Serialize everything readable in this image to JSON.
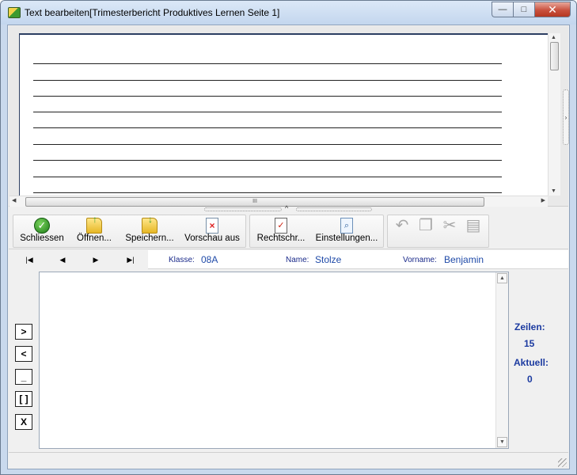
{
  "window": {
    "title": "Text bearbeiten[Trimesterbericht Produktives Lernen Seite 1]"
  },
  "titlebar_buttons": {
    "minimize": "—",
    "maximize": "□",
    "close": "✕"
  },
  "scroll": {
    "hthumb_mark": "III"
  },
  "toolbar": {
    "buttons": [
      {
        "label": "Schliessen",
        "icon": "check-icon"
      },
      {
        "label": "Öffnen...",
        "icon": "open-folder-icon"
      },
      {
        "label": "Speichern...",
        "icon": "save-folder-icon"
      },
      {
        "label": "Vorschau aus",
        "icon": "preview-off-icon"
      },
      {
        "label": "Rechtschr...",
        "icon": "spellcheck-icon"
      },
      {
        "label": "Einstellungen...",
        "icon": "settings-magnifier-icon"
      }
    ],
    "disabled_icons": [
      "undo-icon",
      "copy-icon",
      "cut-icon",
      "paste-icon"
    ]
  },
  "nav": {
    "first": "|◀",
    "prev": "◀",
    "next": "▶",
    "last": "▶|",
    "klasse_label": "Klasse:",
    "klasse_value": "08A",
    "name_label": "Name:",
    "name_value": "Stolze",
    "vorname_label": "Vorname:",
    "vorname_value": "Benjamin"
  },
  "side_buttons": [
    ">",
    "<",
    "_",
    "[ ]",
    "X"
  ],
  "info": {
    "zeilen_label": "Zeilen:",
    "zeilen_value": "15",
    "aktuell_label": "Aktuell:",
    "aktuell_value": "0"
  },
  "colors": {
    "accent": "#1b3aa0",
    "page_border": "#2c3e62"
  }
}
